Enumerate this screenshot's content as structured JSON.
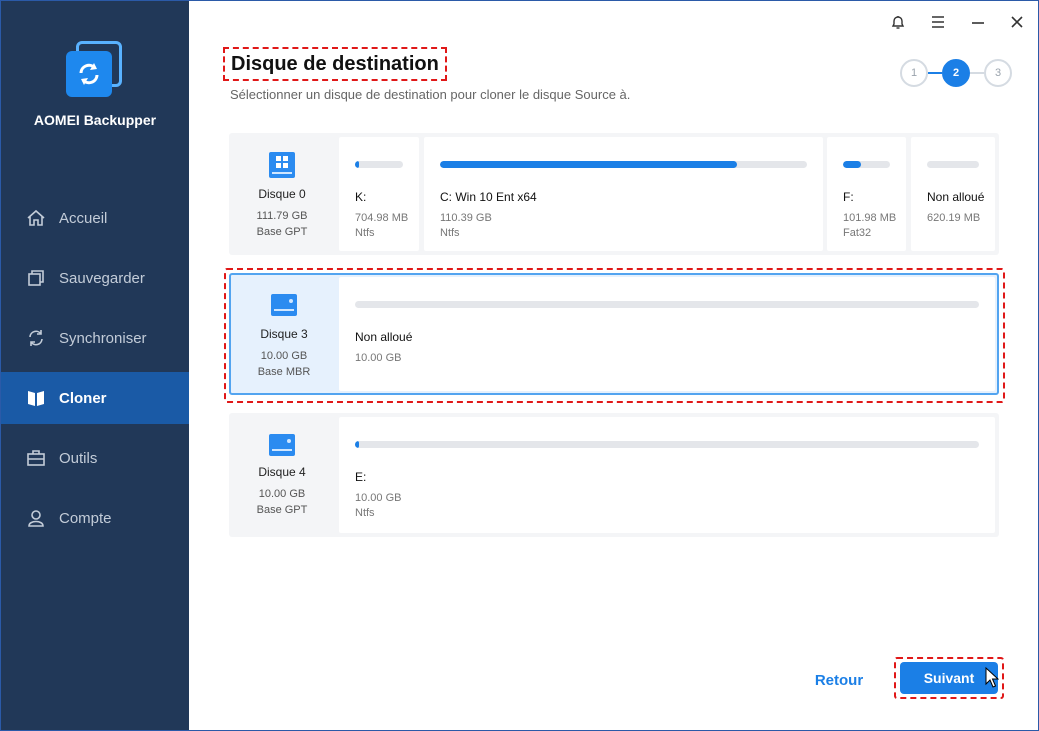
{
  "app": {
    "name": "AOMEI Backupper"
  },
  "icons": {
    "logo": "sync-arrows-icon",
    "bell": "bell-icon",
    "menu": "hamburger-menu-icon",
    "minimize": "minimize-icon",
    "close": "close-icon",
    "disk": "hard-disk-icon"
  },
  "colors": {
    "sidebar": "#213858",
    "sidebar_active": "#1a5aa6",
    "accent": "#1b7fe6",
    "highlight": "#e01818"
  },
  "sidebar": {
    "items": [
      {
        "label": "Accueil",
        "icon": "home-icon",
        "active": false
      },
      {
        "label": "Sauvegarder",
        "icon": "copy-icon",
        "active": false
      },
      {
        "label": "Synchroniser",
        "icon": "sync-icon",
        "active": false
      },
      {
        "label": "Cloner",
        "icon": "clone-icon",
        "active": true
      },
      {
        "label": "Outils",
        "icon": "toolbox-icon",
        "active": false
      },
      {
        "label": "Compte",
        "icon": "user-icon",
        "active": false
      }
    ]
  },
  "header": {
    "title": "Disque de destination",
    "subtitle": "Sélectionner un disque de destination pour cloner le disque Source à."
  },
  "steps": {
    "items": [
      "1",
      "2",
      "3"
    ],
    "current": 2
  },
  "disks": [
    {
      "name": "Disque 0",
      "size": "111.79 GB",
      "type": "Base GPT",
      "partitions": [
        {
          "label": "K:",
          "size": "704.98 MB",
          "fs": "Ntfs",
          "usage": 0.05
        },
        {
          "label": "C: Win 10 Ent x64",
          "size": "110.39 GB",
          "fs": "Ntfs",
          "usage": 0.81
        },
        {
          "label": "F:",
          "size": "101.98 MB",
          "fs": "Fat32",
          "usage": 0.38
        },
        {
          "label": "Non alloué",
          "size": "620.19 MB",
          "fs": "",
          "usage": 0
        }
      ]
    },
    {
      "name": "Disque 3",
      "size": "10.00 GB",
      "type": "Base MBR",
      "selected": true,
      "partitions": [
        {
          "label": "Non alloué",
          "size": "10.00 GB",
          "fs": "",
          "usage": 0
        }
      ]
    },
    {
      "name": "Disque 4",
      "size": "10.00 GB",
      "type": "Base GPT",
      "partitions": [
        {
          "label": "E:",
          "size": "10.00 GB",
          "fs": "Ntfs",
          "usage": 0.006
        }
      ]
    }
  ],
  "buttons": {
    "back": "Retour",
    "next": "Suivant"
  }
}
